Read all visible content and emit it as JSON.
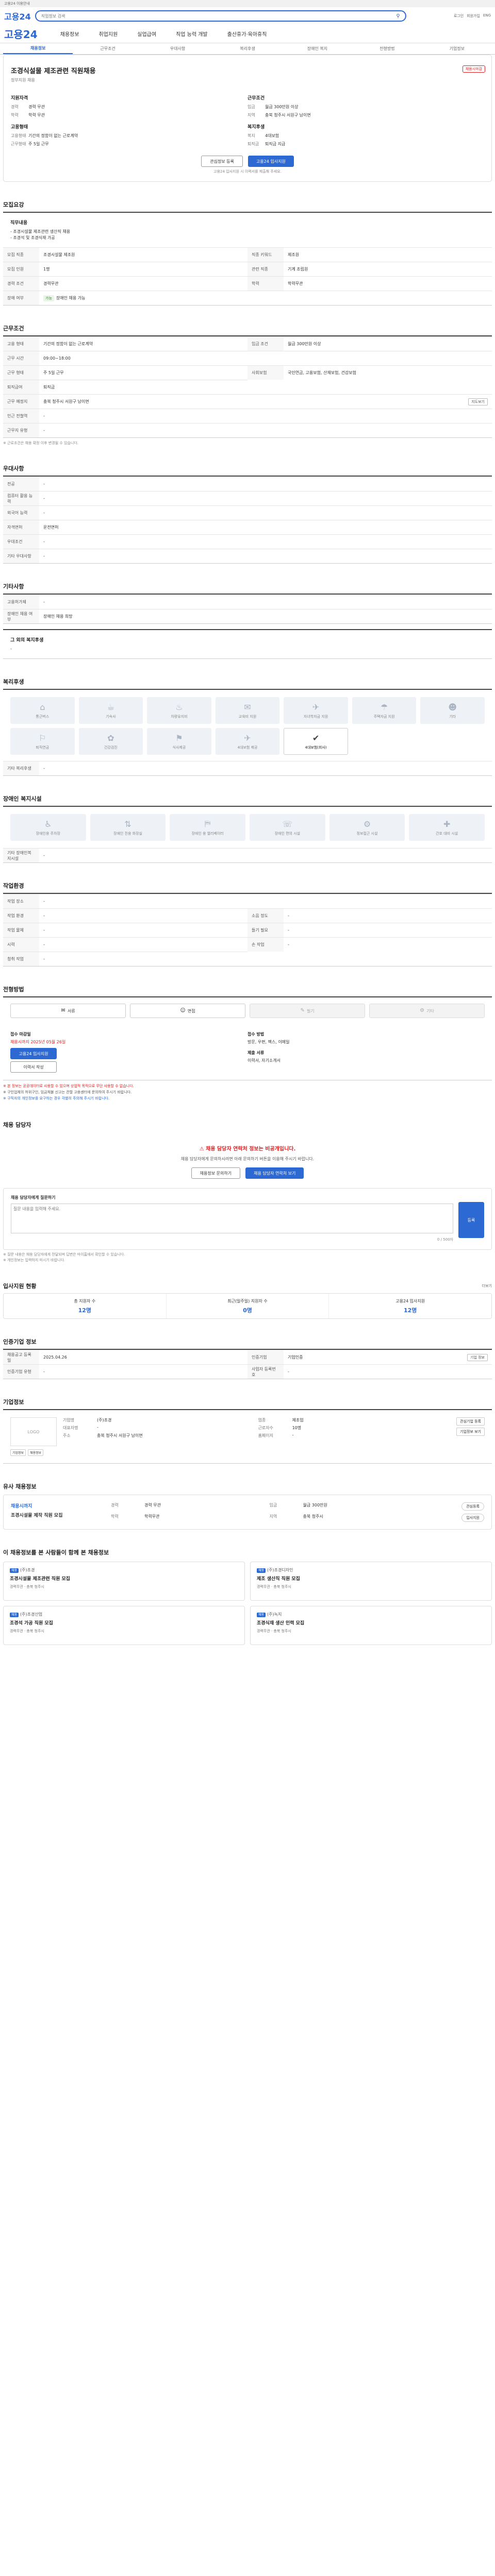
{
  "topbar": {
    "items": [
      "마이홈",
      "로그인",
      "회원가입",
      "고객센터",
      "사이트맵"
    ],
    "notice": "고용24 이용안내"
  },
  "search": {
    "logo": "고용24",
    "placeholder": "직업정보 검색",
    "value": "",
    "util": [
      "로그인",
      "회원가입",
      "ENG"
    ]
  },
  "gnb": {
    "logo": "고용24",
    "items": [
      "채용정보",
      "취업지원",
      "실업급여",
      "직업 능력 개발",
      "출산휴가·육아휴직"
    ]
  },
  "tabs": [
    {
      "label": "채용정보",
      "active": true
    },
    {
      "label": "근무조건",
      "active": false
    },
    {
      "label": "우대사항",
      "active": false
    },
    {
      "label": "복리후생",
      "active": false
    },
    {
      "label": "장애인 복지",
      "active": false
    },
    {
      "label": "전형방법",
      "active": false
    },
    {
      "label": "기업정보",
      "active": false
    }
  ],
  "header": {
    "title": "조경식설물 제조관련 직원채용",
    "gov": "정부지원 채용",
    "tag": "채용시마감"
  },
  "summary": {
    "left_title": "지원자격",
    "left": [
      {
        "k": "경력",
        "v": "경력 무관"
      },
      {
        "k": "학력",
        "v": "학력 무관"
      }
    ],
    "right_title": "근무조건",
    "right": [
      {
        "k": "임금",
        "v": "월급 300만원 이상"
      },
      {
        "k": "지역",
        "v": "충북 청주시 서원구 남이면"
      }
    ],
    "left_title2": "고용형태",
    "left2": [
      {
        "k": "고용형태",
        "v": "기간의 정함이 없는 근로계약"
      },
      {
        "k": "근무형태",
        "v": "주 5일 근무"
      }
    ],
    "right_title2": "복지후생",
    "right2": [
      {
        "k": "복지",
        "v": "4대보험"
      },
      {
        "k": "퇴직금",
        "v": "퇴직금 지급"
      }
    ]
  },
  "actions": {
    "scrap": "관심정보 등록",
    "apply": "고용24 입사지원",
    "note": "고용24 입사지원 시 이력서를 제출해 주세요."
  },
  "sections": {
    "recruit": "모집요강",
    "condition": "근무조건",
    "prefer": "우대사항",
    "etc": "기타사항",
    "welfare": "복리후생",
    "disabled": "장애인 복지시설",
    "work": "작업환경",
    "method": "전형방법",
    "contact": "채용 담당자",
    "stat": "입사지원 현황",
    "info": "인증기업 정보",
    "company": "기업정보",
    "similar": "유사 채용정보",
    "recommend": "이 채용정보를 본 사람들이 함께 본 채용정보"
  },
  "recruit": {
    "duty_label": "직무내용",
    "duty": "- 조경시설물 제조관련 생산직 채용\n- 조경석 및 조경식재 가공",
    "fields": [
      {
        "k": "모집 직종",
        "v": "조경시설물 제조원"
      },
      {
        "k": "직종 키워드",
        "v": "제조원"
      },
      {
        "k": "모집 인원",
        "v": "1명"
      },
      {
        "k": "관련 직종",
        "v": "기계 조립원"
      },
      {
        "k": "경력 조건",
        "v": "경력무관"
      },
      {
        "k": "학력",
        "v": "학력무관"
      },
      {
        "k": "장애 여부",
        "v": "장애인 채용 가능",
        "badge": "가능"
      }
    ]
  },
  "condition": {
    "fields": [
      {
        "k": "고용 형태",
        "v": "기간의 정함이 없는 근로계약"
      },
      {
        "k": "임금 조건",
        "v": "월급 300만원 이상"
      },
      {
        "k": "근무 시간",
        "v": "09:00~18:00"
      },
      {
        "k": "근무 형태",
        "v": "주 5일 근무"
      },
      {
        "k": "사회보험",
        "v": "국민연금, 고용보험, 산재보험, 건강보험"
      },
      {
        "k": "퇴직급여",
        "v": "퇴직금"
      },
      {
        "k": "근무 예정지",
        "v": "충북 청주시 서원구 남이면"
      },
      {
        "k": "인근 전철역",
        "v": "-"
      },
      {
        "k": "근무지 유형",
        "v": "-"
      }
    ],
    "map": "지도보기",
    "note": "※ 근로조건은 채용 확정 이후 변경될 수 있습니다."
  },
  "prefer": [
    {
      "k": "전공",
      "v": "-"
    },
    {
      "k": "컴퓨터 활용 능력",
      "v": "-"
    },
    {
      "k": "외국어 능력",
      "v": "-"
    },
    {
      "k": "자격면허",
      "v": "운전면허"
    },
    {
      "k": "우대조건",
      "v": "-"
    },
    {
      "k": "기타 우대사항",
      "v": "-"
    }
  ],
  "etc": [
    {
      "k": "고용허가제",
      "v": "-"
    },
    {
      "k": "장애인 채용 여부",
      "v": "장애인 채용 희망"
    }
  ],
  "etc2": {
    "label": "그 외의 복지후생",
    "v": "-"
  },
  "welfare": {
    "tiles": [
      {
        "icon": "⌂",
        "label": "통근버스",
        "on": false
      },
      {
        "icon": "☕",
        "label": "기숙사",
        "on": false
      },
      {
        "icon": "♨",
        "label": "차량유지비",
        "on": false
      },
      {
        "icon": "✉",
        "label": "교육비 지원",
        "on": false
      },
      {
        "icon": "✈",
        "label": "자녀학자금 지원",
        "on": false
      },
      {
        "icon": "☂",
        "label": "주택자금 지원",
        "on": false
      },
      {
        "icon": "☻",
        "label": "기타",
        "on": false
      },
      {
        "icon": "⚐",
        "label": "퇴직연금",
        "on": false
      },
      {
        "icon": "✿",
        "label": "건강검진",
        "on": false
      },
      {
        "icon": "⚑",
        "label": "식사제공",
        "on": false
      },
      {
        "icon": "✈",
        "label": "4대보험 제공",
        "on": false
      },
      {
        "icon": "✔",
        "label": "4대보험(회사)",
        "on": true
      }
    ],
    "etc_label": "기타 복리후생",
    "etc_value": "-"
  },
  "disabled": {
    "tiles": [
      {
        "icon": "♿",
        "label": "장애인용 주차장"
      },
      {
        "icon": "⇅",
        "label": "장애인 전용 화장실"
      },
      {
        "icon": "⛿",
        "label": "장애인 용 엘리베이터"
      },
      {
        "icon": "☏",
        "label": "장애인 편의 시설"
      },
      {
        "icon": "⚙",
        "label": "정보접근 시설"
      },
      {
        "icon": "✚",
        "label": "간호 대비 시설"
      }
    ],
    "etc_label": "기타 장애인복지시설",
    "etc_value": "-"
  },
  "work": [
    {
      "k": "작업 장소",
      "v": "-"
    },
    {
      "k": "작업 환경",
      "v": "-"
    },
    {
      "k": "소음 정도",
      "v": "-"
    },
    {
      "k": "작업 물체",
      "v": "-"
    },
    {
      "k": "들기 필요",
      "v": "-"
    },
    {
      "k": "시력",
      "v": "-"
    },
    {
      "k": "손 작업",
      "v": "-"
    },
    {
      "k": "청취 작업",
      "v": "-"
    }
  ],
  "method": {
    "steps": [
      {
        "icon": "✉",
        "label": "서류",
        "on": true
      },
      {
        "icon": "☺",
        "label": "면접",
        "on": true
      },
      {
        "icon": "✎",
        "label": "필기",
        "on": false
      },
      {
        "icon": "⚙",
        "label": "기타",
        "on": false
      }
    ],
    "apply_title": "접수 마감일",
    "apply_value": "채용시까지 2025년 05월 26일",
    "apply_method_title": "접수 방법",
    "apply_method": "방문, 우편, 팩스, 이메일",
    "docs_title": "제출 서류",
    "docs": "이력서, 자기소개서",
    "btn_apply": "고용24 입사지원",
    "btn_doc": "이력서 작성",
    "warn": [
      "※ 본 정보는 공공데이터로 사용할 수 있으며 상업적 목적으로 무단 사용할 수 없습니다.",
      "※ 구인업체의 허위구인, 임금체불 신고는 관할 고용센터에 문의하여 주시기 바랍니다.",
      "※ 구직자의 개인정보를 요구하는 경우 각별히 주의해 주시기 바랍니다."
    ]
  },
  "contact": {
    "a1": "채용 담당자 연락처 정보는 비공개입니다.",
    "a2": "채용 담당자에게 문의하시려면 아래 문의하기 버튼을 이용해 주시기 바랍니다.",
    "b1": "채용정보 문의하기",
    "b2": "채용 담당자 연락처 보기",
    "q_title": "채용 담당자에게 질문하기",
    "q_placeholder": "질문 내용을 입력해 주세요.",
    "q_btn": "등록",
    "q_notes": [
      "※ 질문 내용은 채용 담당자에게 전달되며 답변은 마이홈에서 확인할 수 있습니다.",
      "※ 개인정보는 입력하지 마시기 바랍니다."
    ],
    "q_count": "0 / 500자"
  },
  "stat": {
    "more": "더보기",
    "items": [
      {
        "label": "총 지원자 수",
        "value": "12명"
      },
      {
        "label": "최근(일주일) 지원자 수",
        "value": "0명"
      },
      {
        "label": "고용24 입사지원",
        "value": "12명"
      }
    ]
  },
  "info": [
    {
      "k": "채용공고 등록일",
      "v": "2025.04.26"
    },
    {
      "k": "인증기업",
      "v": "기업인증"
    },
    {
      "k": "인증기업 유형",
      "v": "-"
    },
    {
      "k": "사업자 등록번호",
      "v": "-"
    }
  ],
  "info_btn": "기업 정보",
  "company": {
    "logo": "LOGO",
    "badges": [
      "기업정보",
      "채용정보"
    ],
    "rows": [
      {
        "k": "기업명",
        "v": "(주)조경"
      },
      {
        "k": "업종",
        "v": "제조업"
      },
      {
        "k": "대표자명",
        "v": "-"
      },
      {
        "k": "근로자수",
        "v": "10명"
      },
      {
        "k": "주소",
        "v": "충북 청주시 서원구 남이면"
      },
      {
        "k": "홈페이지",
        "v": "-"
      }
    ],
    "btns": [
      "관심기업 등록",
      "기업정보 보기"
    ]
  },
  "similar": {
    "t1": "채용시까지",
    "t2": "조경시설물 제작 직원 모집",
    "rows": [
      {
        "k": "경력",
        "v": "경력 무관"
      },
      {
        "k": "임금",
        "v": "월급 300만원"
      },
      {
        "k": "학력",
        "v": "학력무관"
      },
      {
        "k": "지역",
        "v": "충북 청주시"
      }
    ],
    "tags": [
      "관심등록",
      "입사지원"
    ]
  },
  "recs": [
    {
      "tag": "채용",
      "co": "(주)조경",
      "title": "조경시설물 제조관련 직원 모집",
      "meta": "경력무관 · 충북 청주시"
    },
    {
      "tag": "채용",
      "co": "(주)조경디자인",
      "title": "제조 생산직 직원 모집",
      "meta": "경력무관 · 충북 청주시"
    },
    {
      "tag": "채용",
      "co": "(주)조경산업",
      "title": "조경석 가공 직원 모집",
      "meta": "경력무관 · 충북 청주시"
    },
    {
      "tag": "채용",
      "co": "(주)녹지",
      "title": "조경식재 생산 인력 모집",
      "meta": "경력무관 · 충북 청주시"
    }
  ]
}
